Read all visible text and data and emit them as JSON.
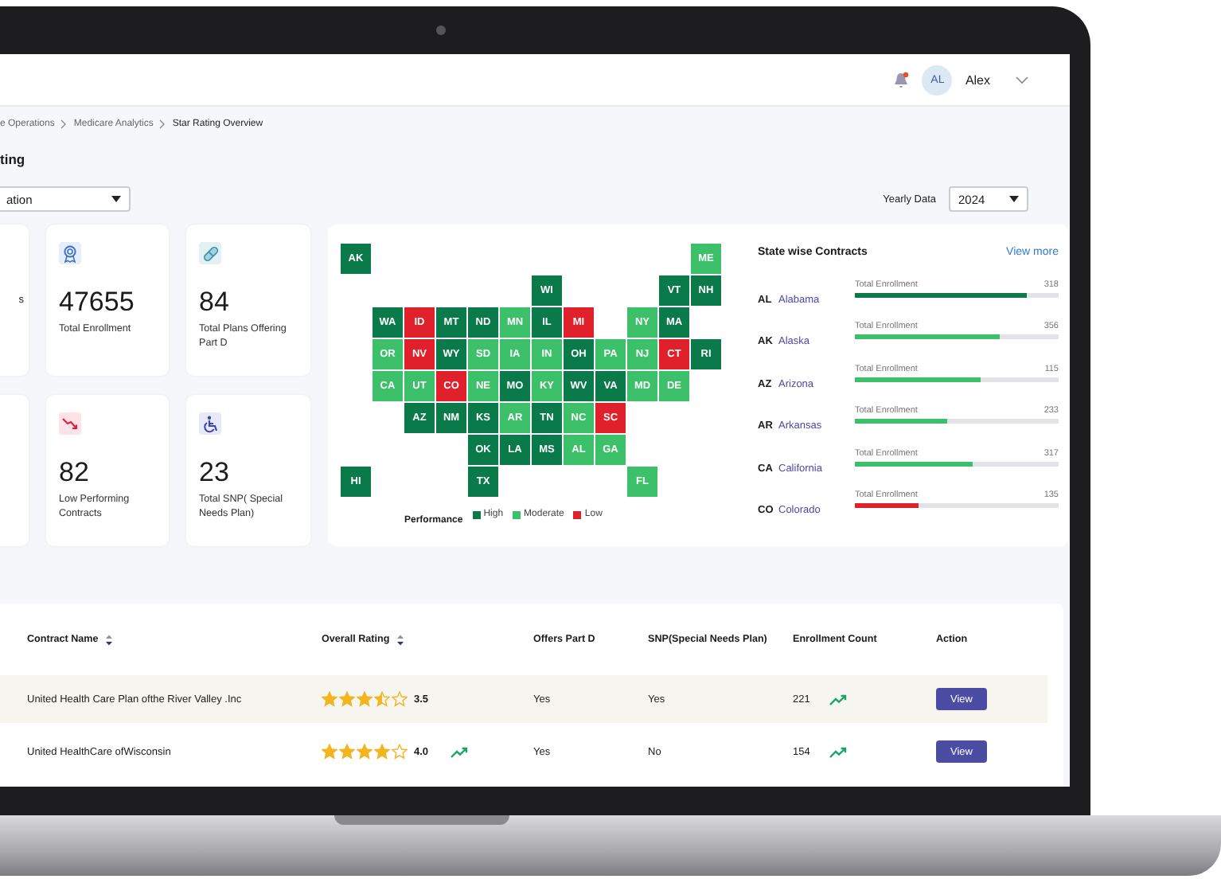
{
  "topbar": {
    "notification": true,
    "avatar": "AL",
    "user": "Alex"
  },
  "breadcrumb": [
    "e Operations",
    "Medicare Analytics",
    "Star Rating Overview"
  ],
  "page_title": "ting",
  "filter": {
    "value": "ation"
  },
  "yearly": {
    "label": "Yearly Data",
    "value": "2024"
  },
  "cards": [
    {
      "kind": "partial",
      "label": "s"
    },
    {
      "kind": "stat",
      "value": "47655",
      "label": "Total Enrollment"
    },
    {
      "kind": "stat",
      "value": "84",
      "label": "Total Plans Offering Part D"
    },
    {
      "kind": "partial"
    },
    {
      "kind": "stat",
      "value": "82",
      "label": "Low Performing Contracts"
    },
    {
      "kind": "stat",
      "value": "23",
      "label": "Total SNP( Special Needs Plan)"
    }
  ],
  "map": {
    "legend_title": "Performance",
    "legend": [
      {
        "label": "High",
        "color": "#0b7a4b"
      },
      {
        "label": "Moderate",
        "color": "#3cc06a"
      },
      {
        "label": "Low",
        "color": "#e0202a"
      }
    ],
    "states": [
      {
        "code": "AK",
        "color": "#0b7a4b"
      },
      {
        "code": "ME",
        "color": "#3cc06a"
      },
      {
        "code": "WI",
        "color": "#0b7a4b"
      },
      {
        "code": "VT",
        "color": "#0b7a4b"
      },
      {
        "code": "NH",
        "color": "#0b7a4b"
      },
      {
        "code": "WA",
        "color": "#0b7a4b"
      },
      {
        "code": "ID",
        "color": "#e0202a"
      },
      {
        "code": "MT",
        "color": "#0b7a4b"
      },
      {
        "code": "ND",
        "color": "#0b7a4b"
      },
      {
        "code": "MN",
        "color": "#3cc06a"
      },
      {
        "code": "IL",
        "color": "#0b7a4b"
      },
      {
        "code": "MI",
        "color": "#e0202a"
      },
      {
        "code": "NY",
        "color": "#3cc06a"
      },
      {
        "code": "MA",
        "color": "#0b7a4b"
      },
      {
        "code": "OR",
        "color": "#3cc06a"
      },
      {
        "code": "NV",
        "color": "#e0202a"
      },
      {
        "code": "WY",
        "color": "#0b7a4b"
      },
      {
        "code": "SD",
        "color": "#3cc06a"
      },
      {
        "code": "IA",
        "color": "#3cc06a"
      },
      {
        "code": "IN",
        "color": "#3cc06a"
      },
      {
        "code": "OH",
        "color": "#0b7a4b"
      },
      {
        "code": "PA",
        "color": "#3cc06a"
      },
      {
        "code": "NJ",
        "color": "#3cc06a"
      },
      {
        "code": "CT",
        "color": "#e0202a"
      },
      {
        "code": "RI",
        "color": "#0b7a4b"
      },
      {
        "code": "CA",
        "color": "#3cc06a"
      },
      {
        "code": "UT",
        "color": "#3cc06a"
      },
      {
        "code": "CO",
        "color": "#e0202a"
      },
      {
        "code": "NE",
        "color": "#3cc06a"
      },
      {
        "code": "MO",
        "color": "#0b7a4b"
      },
      {
        "code": "KY",
        "color": "#3cc06a"
      },
      {
        "code": "WV",
        "color": "#0b7a4b"
      },
      {
        "code": "VA",
        "color": "#0b7a4b"
      },
      {
        "code": "MD",
        "color": "#3cc06a"
      },
      {
        "code": "DE",
        "color": "#3cc06a"
      },
      {
        "code": "AZ",
        "color": "#0b7a4b"
      },
      {
        "code": "NM",
        "color": "#0b7a4b"
      },
      {
        "code": "KS",
        "color": "#0b7a4b"
      },
      {
        "code": "AR",
        "color": "#3cc06a"
      },
      {
        "code": "TN",
        "color": "#0b7a4b"
      },
      {
        "code": "NC",
        "color": "#3cc06a"
      },
      {
        "code": "SC",
        "color": "#e0202a"
      },
      {
        "code": "OK",
        "color": "#0b7a4b"
      },
      {
        "code": "LA",
        "color": "#0b7a4b"
      },
      {
        "code": "MS",
        "color": "#0b7a4b"
      },
      {
        "code": "AL",
        "color": "#3cc06a"
      },
      {
        "code": "GA",
        "color": "#3cc06a"
      },
      {
        "code": "HI",
        "color": "#0b7a4b"
      },
      {
        "code": "TX",
        "color": "#0b7a4b"
      },
      {
        "code": "FL",
        "color": "#3cc06a"
      }
    ]
  },
  "contracts": {
    "title": "State wise Contracts",
    "link": "View more",
    "rows": [
      {
        "code": "AL",
        "name": "Alabama",
        "metric": "Total Enrollment",
        "value": "318",
        "level": 0.84,
        "color": "#0b7a4b"
      },
      {
        "code": "AK",
        "name": "Alaska",
        "metric": "Total Enrollment",
        "value": "356",
        "level": 0.71,
        "color": "#3cc06a"
      },
      {
        "code": "AZ",
        "name": "Arizona",
        "metric": "Total Enrollment",
        "value": "115",
        "level": 0.62,
        "color": "#3cc06a"
      },
      {
        "code": "AR",
        "name": "Arkansas",
        "metric": "Total Enrollment",
        "value": "233",
        "level": 0.45,
        "color": "#3cc06a"
      },
      {
        "code": "CA",
        "name": "California",
        "metric": "Total Enrollment",
        "value": "317",
        "level": 0.58,
        "color": "#3cc06a"
      },
      {
        "code": "CO",
        "name": "Colorado",
        "metric": "Total Enrollment",
        "value": "135",
        "level": 0.31,
        "color": "#e0202a"
      }
    ]
  },
  "table": {
    "columns": [
      {
        "label": "Contract Name",
        "sortable": true
      },
      {
        "label": "Overall Rating",
        "sortable": true
      },
      {
        "label": "Offers Part D",
        "sortable": false
      },
      {
        "label": "SNP(Special Needs Plan)",
        "sortable": false
      },
      {
        "label": "Enrollment Count",
        "sortable": false
      },
      {
        "label": "Action",
        "sortable": false
      }
    ],
    "rows": [
      {
        "selected": true,
        "name": "United Health Care Plan ofthe River Valley .Inc",
        "stars": 3.5,
        "rating": "3.5",
        "rating_trend": false,
        "part_d": "Yes",
        "snp": "Yes",
        "enrollment": "221",
        "enrollment_trend": true,
        "action": "View"
      },
      {
        "selected": false,
        "name": "United HealthCare ofWisconsin",
        "stars": 4,
        "rating": "4.0",
        "rating_trend": true,
        "part_d": "Yes",
        "snp": "No",
        "enrollment": "154",
        "enrollment_trend": true,
        "action": "View"
      }
    ]
  }
}
